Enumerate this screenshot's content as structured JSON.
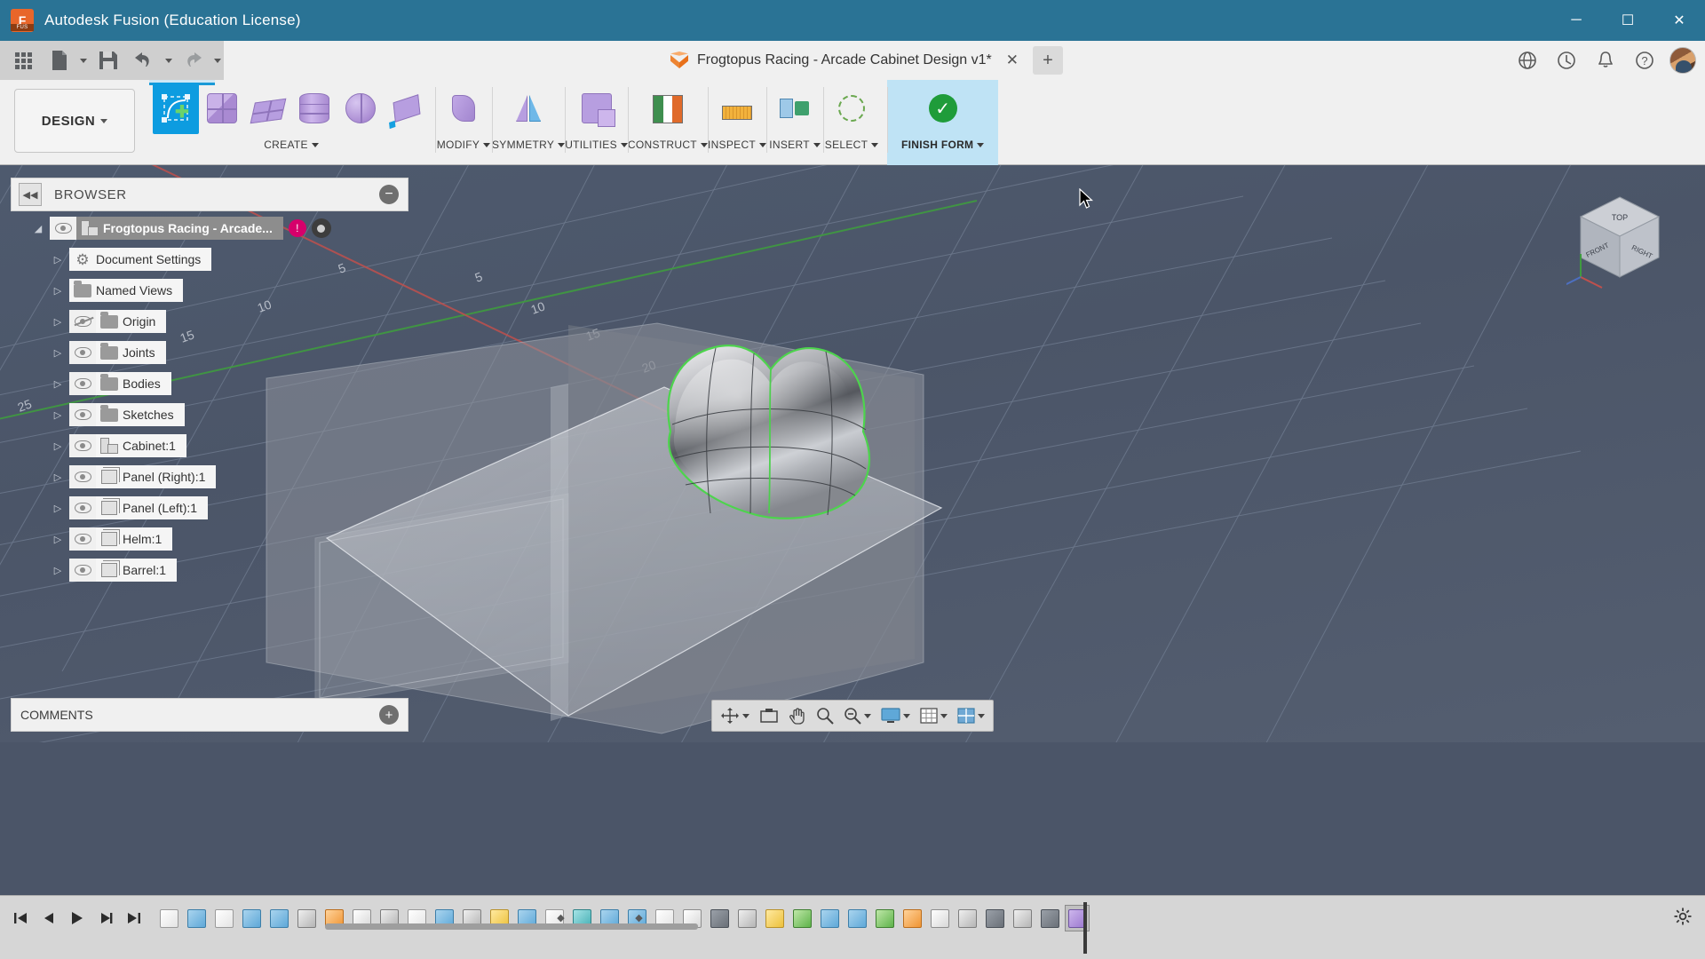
{
  "window": {
    "app_title": "Autodesk Fusion (Education License)",
    "logo_text": "F",
    "logo_sub": "FUS",
    "minimize": "─",
    "maximize": "☐",
    "close": "✕"
  },
  "quick_access": {
    "items": [
      {
        "name": "app-grid-button",
        "icon": "grid-icon",
        "has_caret": false
      },
      {
        "name": "new-file-button",
        "icon": "file-icon",
        "has_caret": true
      },
      {
        "name": "save-button",
        "icon": "save-icon",
        "has_caret": false
      },
      {
        "name": "undo-button",
        "icon": "undo-icon",
        "has_caret": true
      },
      {
        "name": "redo-button",
        "icon": "redo-icon",
        "has_caret": true
      }
    ]
  },
  "document_tab": {
    "title": "Frogtopus Racing - Arcade Cabinet Design v1*",
    "icon": "orange-cube-icon",
    "close_label": "✕",
    "new_tab_label": "+"
  },
  "header_icons": [
    {
      "name": "data-panel-icon",
      "glyph": "◷"
    },
    {
      "name": "job-status-icon",
      "glyph": "◴"
    },
    {
      "name": "notifications-icon",
      "glyph": "ὑ4"
    },
    {
      "name": "help-icon",
      "glyph": "?"
    }
  ],
  "ribbon": {
    "workspace": {
      "label": "DESIGN",
      "caret": "▾"
    },
    "active_tab": "FORM",
    "groups": [
      {
        "name": "create",
        "label": "CREATE",
        "caret": true,
        "tools": [
          {
            "name": "form-create-base-feature",
            "icon": "create-form-icon",
            "active": true
          },
          {
            "name": "form-box",
            "icon": "box-icon",
            "active": false
          },
          {
            "name": "form-plane",
            "icon": "plane-icon",
            "active": false
          },
          {
            "name": "form-cylinder",
            "icon": "cylinder-icon",
            "active": false
          },
          {
            "name": "form-sphere",
            "icon": "sphere-icon",
            "active": false
          },
          {
            "name": "form-quadball",
            "icon": "quadball-icon",
            "active": false
          }
        ]
      },
      {
        "name": "modify",
        "label": "MODIFY",
        "caret": true,
        "tools": [
          {
            "name": "form-edit-form",
            "icon": "edit-form-icon",
            "active": false
          }
        ]
      },
      {
        "name": "symmetry",
        "label": "SYMMETRY",
        "caret": true,
        "tools": [
          {
            "name": "form-mirror-internal",
            "icon": "mirror-icon",
            "active": false
          }
        ]
      },
      {
        "name": "utilities",
        "label": "UTILITIES",
        "caret": true,
        "tools": [
          {
            "name": "form-display-mode",
            "icon": "display-mode-icon",
            "active": false
          }
        ]
      },
      {
        "name": "construct",
        "label": "CONSTRUCT",
        "caret": true,
        "tools": [
          {
            "name": "construct-offset-plane",
            "icon": "construct-plane-icon",
            "active": false
          }
        ]
      },
      {
        "name": "inspect",
        "label": "INSPECT",
        "caret": true,
        "tools": [
          {
            "name": "inspect-measure",
            "icon": "measure-icon",
            "active": false
          }
        ]
      },
      {
        "name": "insert",
        "label": "INSERT",
        "caret": true,
        "tools": [
          {
            "name": "insert-derive",
            "icon": "insert-icon",
            "active": false
          }
        ]
      },
      {
        "name": "select",
        "label": "SELECT",
        "caret": true,
        "tools": [
          {
            "name": "select-tool",
            "icon": "select-lasso-icon",
            "active": false
          }
        ]
      },
      {
        "name": "finish-form",
        "label": "FINISH FORM",
        "caret": true,
        "highlighted": true,
        "tools": [
          {
            "name": "finish-form-button",
            "icon": "green-check-icon",
            "active": false
          }
        ]
      }
    ]
  },
  "browser": {
    "panel_title": "BROWSER",
    "collapse_glyph": "◀◀",
    "minimize_glyph": "−",
    "nodes": [
      {
        "label": "Frogtopus Racing - Arcade...",
        "icon": "component-icon",
        "visible": true,
        "root": true,
        "badge": "lock",
        "badge_text": "!",
        "dot": true
      },
      {
        "label": "Document Settings",
        "icon": "gear-icon",
        "visible": null,
        "indent": 1
      },
      {
        "label": "Named Views",
        "icon": "folder-icon",
        "visible": null,
        "indent": 1
      },
      {
        "label": "Origin",
        "icon": "folder-icon",
        "visible": false,
        "indent": 1
      },
      {
        "label": "Joints",
        "icon": "folder-icon",
        "visible": true,
        "indent": 1
      },
      {
        "label": "Bodies",
        "icon": "folder-icon",
        "visible": true,
        "indent": 1
      },
      {
        "label": "Sketches",
        "icon": "folder-icon",
        "visible": true,
        "indent": 1
      },
      {
        "label": "Cabinet:1",
        "icon": "component-icon",
        "visible": true,
        "indent": 1
      },
      {
        "label": "Panel (Right):1",
        "icon": "body-icon",
        "visible": true,
        "indent": 1
      },
      {
        "label": "Panel (Left):1",
        "icon": "body-icon",
        "visible": true,
        "indent": 1
      },
      {
        "label": "Helm:1",
        "icon": "body-icon",
        "visible": true,
        "indent": 1
      },
      {
        "label": "Barrel:1",
        "icon": "body-icon",
        "visible": true,
        "indent": 1
      }
    ]
  },
  "comments": {
    "title": "COMMENTS",
    "add_glyph": "+"
  },
  "viewport": {
    "grid_labels": [
      "5",
      "5",
      "10",
      "10",
      "15",
      "15",
      "20",
      "25",
      "25"
    ],
    "colors": {
      "x_axis": "#c0504d",
      "y_axis": "#3f9b3f",
      "background": "#4b5568"
    }
  },
  "view_cube": {
    "faces": {
      "top": "TOP",
      "front": "FRONT",
      "right": "RIGHT"
    }
  },
  "navbar": {
    "items": [
      {
        "name": "orbit-button",
        "icon": "orbit-icon",
        "caret": true
      },
      {
        "name": "pan-look-at-button",
        "icon": "look-at-icon",
        "caret": false
      },
      {
        "name": "pan-button",
        "icon": "hand-icon",
        "caret": false
      },
      {
        "name": "zoom-button",
        "icon": "zoom-icon",
        "caret": false
      },
      {
        "name": "zoom-window-button",
        "icon": "zoom-window-icon",
        "caret": true
      },
      {
        "name": "display-settings-button",
        "icon": "monitor-icon",
        "caret": true
      },
      {
        "name": "grid-snaps-button",
        "icon": "grid-icon",
        "caret": true
      },
      {
        "name": "viewports-button",
        "icon": "viewports-icon",
        "caret": true
      }
    ]
  },
  "timeline": {
    "playback": [
      {
        "name": "timeline-go-start",
        "glyph": "⏮"
      },
      {
        "name": "timeline-step-back",
        "glyph": "◀"
      },
      {
        "name": "timeline-play",
        "glyph": "▶"
      },
      {
        "name": "timeline-step-forward",
        "glyph": "▶❘"
      },
      {
        "name": "timeline-go-end",
        "glyph": "⏭"
      }
    ],
    "features": [
      {
        "name": "sketch-feature",
        "color": "c-sketch"
      },
      {
        "name": "extrude-feature",
        "color": "c-blue"
      },
      {
        "name": "sketch-feature",
        "color": "c-sketch"
      },
      {
        "name": "extrude-feature",
        "color": "c-blue"
      },
      {
        "name": "extrude-feature",
        "color": "c-blue"
      },
      {
        "name": "fillet-feature",
        "color": "c-gray"
      },
      {
        "name": "shell-feature",
        "color": "c-orange"
      },
      {
        "name": "draft-feature",
        "color": "c-white"
      },
      {
        "name": "pattern-feature",
        "color": "c-gray"
      },
      {
        "name": "sketch-feature",
        "color": "c-sketch"
      },
      {
        "name": "extrude-feature",
        "color": "c-blue"
      },
      {
        "name": "joint-feature",
        "color": "c-gray"
      },
      {
        "name": "new-component-feature",
        "color": "c-yellow"
      },
      {
        "name": "chamfer-feature",
        "color": "c-blue"
      },
      {
        "name": "sketch-feature",
        "color": "c-sketch"
      },
      {
        "name": "revolve-feature",
        "color": "c-teal"
      },
      {
        "name": "pattern-feature",
        "color": "c-blue"
      },
      {
        "name": "extrude-feature",
        "color": "c-blue"
      },
      {
        "name": "sketch-feature",
        "color": "c-sketch"
      },
      {
        "name": "combine-feature",
        "color": "c-white"
      },
      {
        "name": "hole-feature",
        "color": "c-dark"
      },
      {
        "name": "mirror-feature",
        "color": "c-gray"
      },
      {
        "name": "thread-feature",
        "color": "c-yellow"
      },
      {
        "name": "rib-feature",
        "color": "c-green"
      },
      {
        "name": "split-feature",
        "color": "c-blue"
      },
      {
        "name": "offset-feature",
        "color": "c-blue"
      },
      {
        "name": "sweep-feature",
        "color": "c-green"
      },
      {
        "name": "loft-feature",
        "color": "c-orange"
      },
      {
        "name": "appearance-feature",
        "color": "c-white"
      },
      {
        "name": "align-feature",
        "color": "c-gray"
      },
      {
        "name": "move-feature",
        "color": "c-dark"
      },
      {
        "name": "copy-feature",
        "color": "c-gray"
      },
      {
        "name": "move-copy-feature",
        "color": "c-dark"
      },
      {
        "name": "form-feature",
        "color": "c-purple",
        "selected": true
      }
    ],
    "settings_glyph": "⚙"
  }
}
